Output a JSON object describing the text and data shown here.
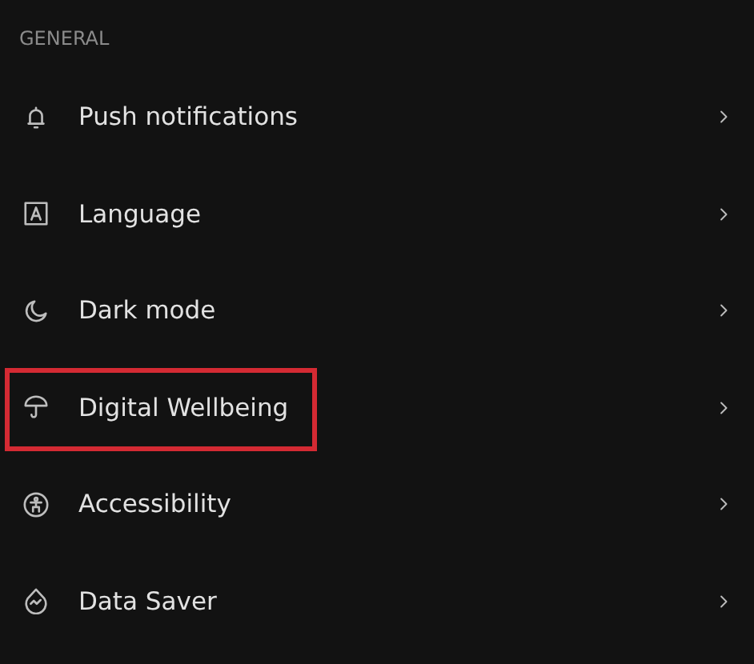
{
  "section": {
    "title": "GENERAL"
  },
  "items": [
    {
      "label": "Push notifications",
      "highlighted": false
    },
    {
      "label": "Language",
      "highlighted": false
    },
    {
      "label": "Dark mode",
      "highlighted": false
    },
    {
      "label": "Digital Wellbeing",
      "highlighted": true
    },
    {
      "label": "Accessibility",
      "highlighted": false
    },
    {
      "label": "Data Saver",
      "highlighted": false
    }
  ]
}
